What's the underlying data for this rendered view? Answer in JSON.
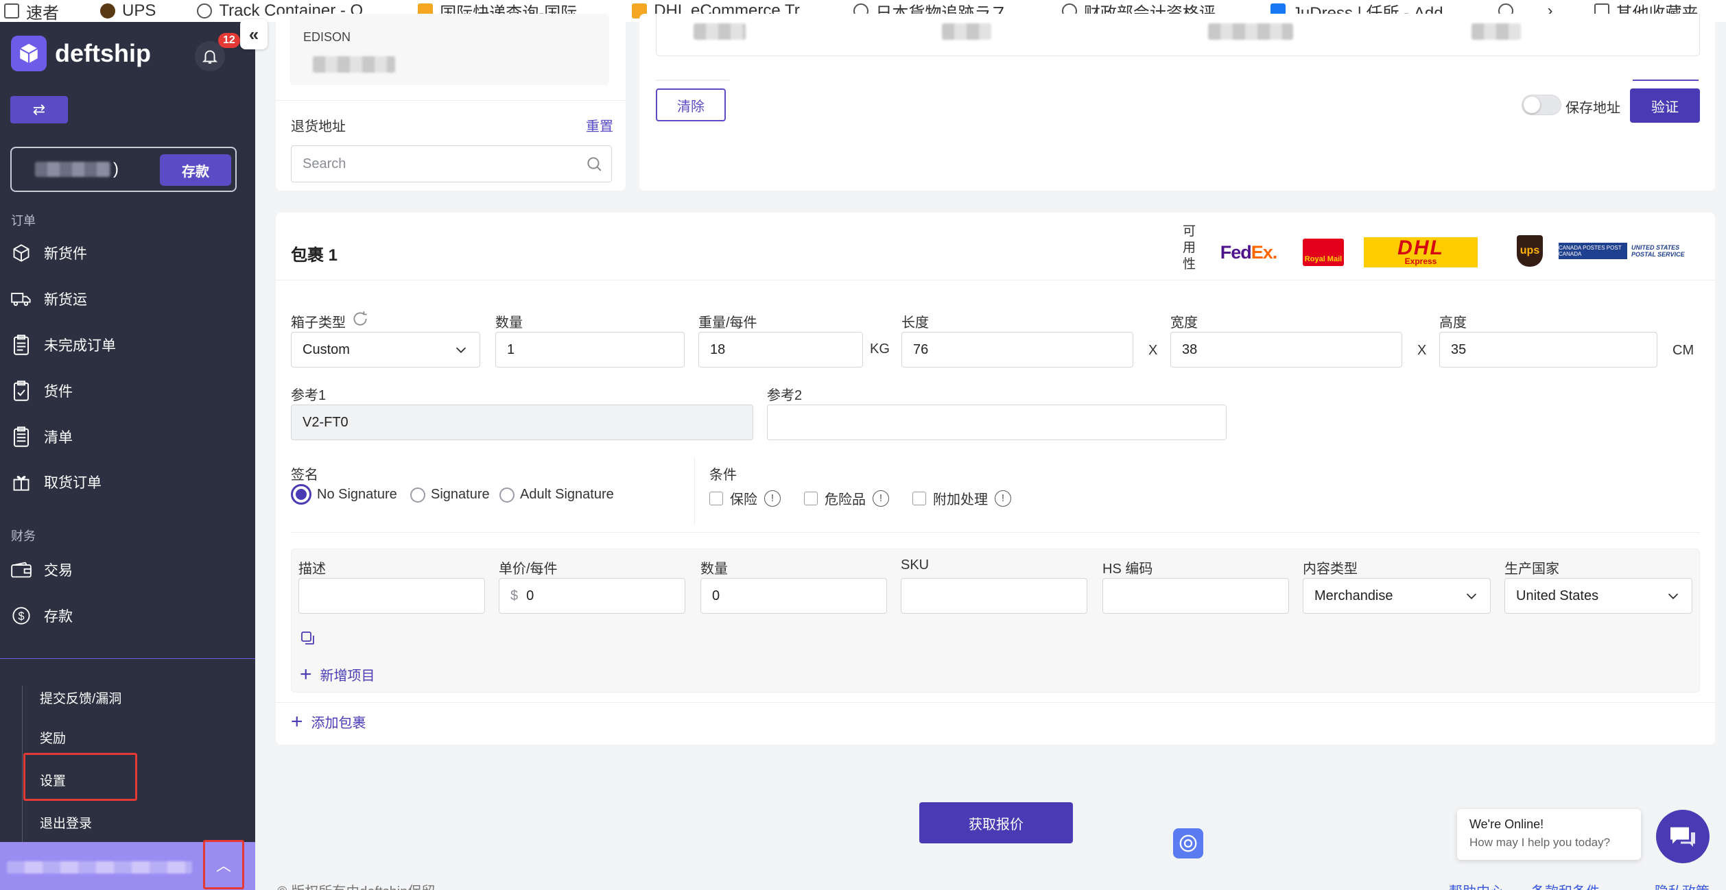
{
  "bookmarks": [
    {
      "label": "速者",
      "icon": "page-icon"
    },
    {
      "label": "UPS",
      "icon": "ups-icon"
    },
    {
      "label": "Track Container - O...",
      "icon": "globe-icon"
    },
    {
      "label": "国际快递查询-国际...",
      "icon": "star-icon"
    },
    {
      "label": "DHL eCommerce Tr...",
      "icon": "folder-icon"
    },
    {
      "label": "日本貨物追跡ラス...",
      "icon": "globe-icon"
    },
    {
      "label": "财政部会计资格评...",
      "icon": "globe-icon"
    },
    {
      "label": "JuDress | 任所 - Add...",
      "icon": "facebook-icon"
    },
    {
      "label": "",
      "icon": "globe-icon"
    },
    {
      "label": "其他收藏夹",
      "icon": "folder-icon"
    }
  ],
  "sidebar": {
    "brand": "deftship",
    "notification_count": "12",
    "deposit_label": "存款",
    "balance_suffix": ")",
    "section_orders": "订单",
    "section_finance": "财务",
    "orders": [
      {
        "label": "新货件",
        "icon": "box-icon"
      },
      {
        "label": "新货运",
        "icon": "truck-icon"
      },
      {
        "label": "未完成订单",
        "icon": "clipboard-icon"
      },
      {
        "label": "货件",
        "icon": "clipboard-check-icon"
      },
      {
        "label": "清单",
        "icon": "list-icon"
      },
      {
        "label": "取货订单",
        "icon": "pickup-icon"
      }
    ],
    "finance": [
      {
        "label": "交易",
        "icon": "wallet-icon"
      },
      {
        "label": "存款",
        "icon": "dollar-icon"
      }
    ],
    "sub_items": [
      {
        "label": "提交反馈/漏洞"
      },
      {
        "label": "奖励"
      },
      {
        "label": "设置"
      },
      {
        "label": "退出登录"
      }
    ]
  },
  "address": {
    "partial_line": "EDISON",
    "return_label": "退货地址",
    "reset_label": "重置",
    "search_placeholder": "Search",
    "clear_label": "清除",
    "save_address_label": "保存地址",
    "verify_label": "验证"
  },
  "package": {
    "title": "包裹 1",
    "availability_label": "可用性",
    "carriers": [
      "FedEx",
      "Royal Mail",
      "DHL Express",
      "UPS",
      "Canada Post",
      "United States Postal Service"
    ],
    "box_type_label": "箱子类型",
    "box_type_value": "Custom",
    "qty_label": "数量",
    "qty_value": "1",
    "weight_label": "重量/每件",
    "weight_value": "18",
    "weight_unit": "KG",
    "length_label": "长度",
    "length_value": "76",
    "width_label": "宽度",
    "width_value": "38",
    "height_label": "高度",
    "height_value": "35",
    "x_sep": "X",
    "dim_unit": "CM",
    "ref1_label": "参考1",
    "ref1_value": "V2-FT0",
    "ref2_label": "参考2",
    "ref2_value": "",
    "signature_label": "签名",
    "signature_options": [
      "No Signature",
      "Signature",
      "Adult Signature"
    ],
    "signature_selected": "No Signature",
    "conditions_label": "条件",
    "conditions": [
      "保险",
      "危险品",
      "附加处理"
    ]
  },
  "items": {
    "headers": [
      "描述",
      "单价/每件",
      "数量",
      "SKU",
      "HS 编码",
      "内容类型",
      "生产国家"
    ],
    "row": {
      "description": "",
      "currency": "$",
      "unit_price": "0",
      "quantity": "0",
      "sku": "",
      "hs_code": "",
      "content_type": "Merchandise",
      "country": "United States"
    },
    "add_item_label": "新增项目",
    "add_package_label": "添加包裹"
  },
  "footer": {
    "quote_label": "获取报价",
    "copyright": "© 版权所有由deftship保留",
    "links": [
      "帮助中心",
      "条款和条件",
      "隐私政策"
    ]
  },
  "chat": {
    "title": "We're Online!",
    "subtitle": "How may I help you today?"
  },
  "colors": {
    "accent": "#4a3bb5",
    "sidebar_bg": "#2d3040",
    "highlight_red": "#e53935"
  }
}
